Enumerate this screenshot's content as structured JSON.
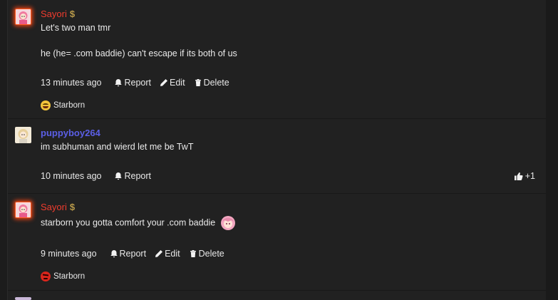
{
  "posts": [
    {
      "author": "Sayori",
      "badge": "$",
      "lines": [
        "Let's two man tmr",
        "",
        "he (he= .com baddie) can't escape if its both of us"
      ],
      "time": "13 minutes ago",
      "actions": [
        "Report",
        "Edit",
        "Delete"
      ],
      "reaction": {
        "emoji": "loudly-crying-face",
        "name": "Starborn"
      }
    },
    {
      "author": "puppyboy264",
      "lines": [
        "im subhuman and wierd let me be TwT"
      ],
      "time": "10 minutes ago",
      "actions": [
        "Report"
      ],
      "votes": "+1"
    },
    {
      "author": "Sayori",
      "badge": "$",
      "lines": [
        "starborn you gotta comfort your .com baddie"
      ],
      "time": "9 minutes ago",
      "actions": [
        "Report",
        "Edit",
        "Delete"
      ],
      "reaction": {
        "emoji": "angry-face",
        "name": "Starborn"
      }
    }
  ],
  "colors": {
    "sayori": "#f03c2e",
    "puppyboy": "#5b5fe6",
    "background": "#212121"
  }
}
